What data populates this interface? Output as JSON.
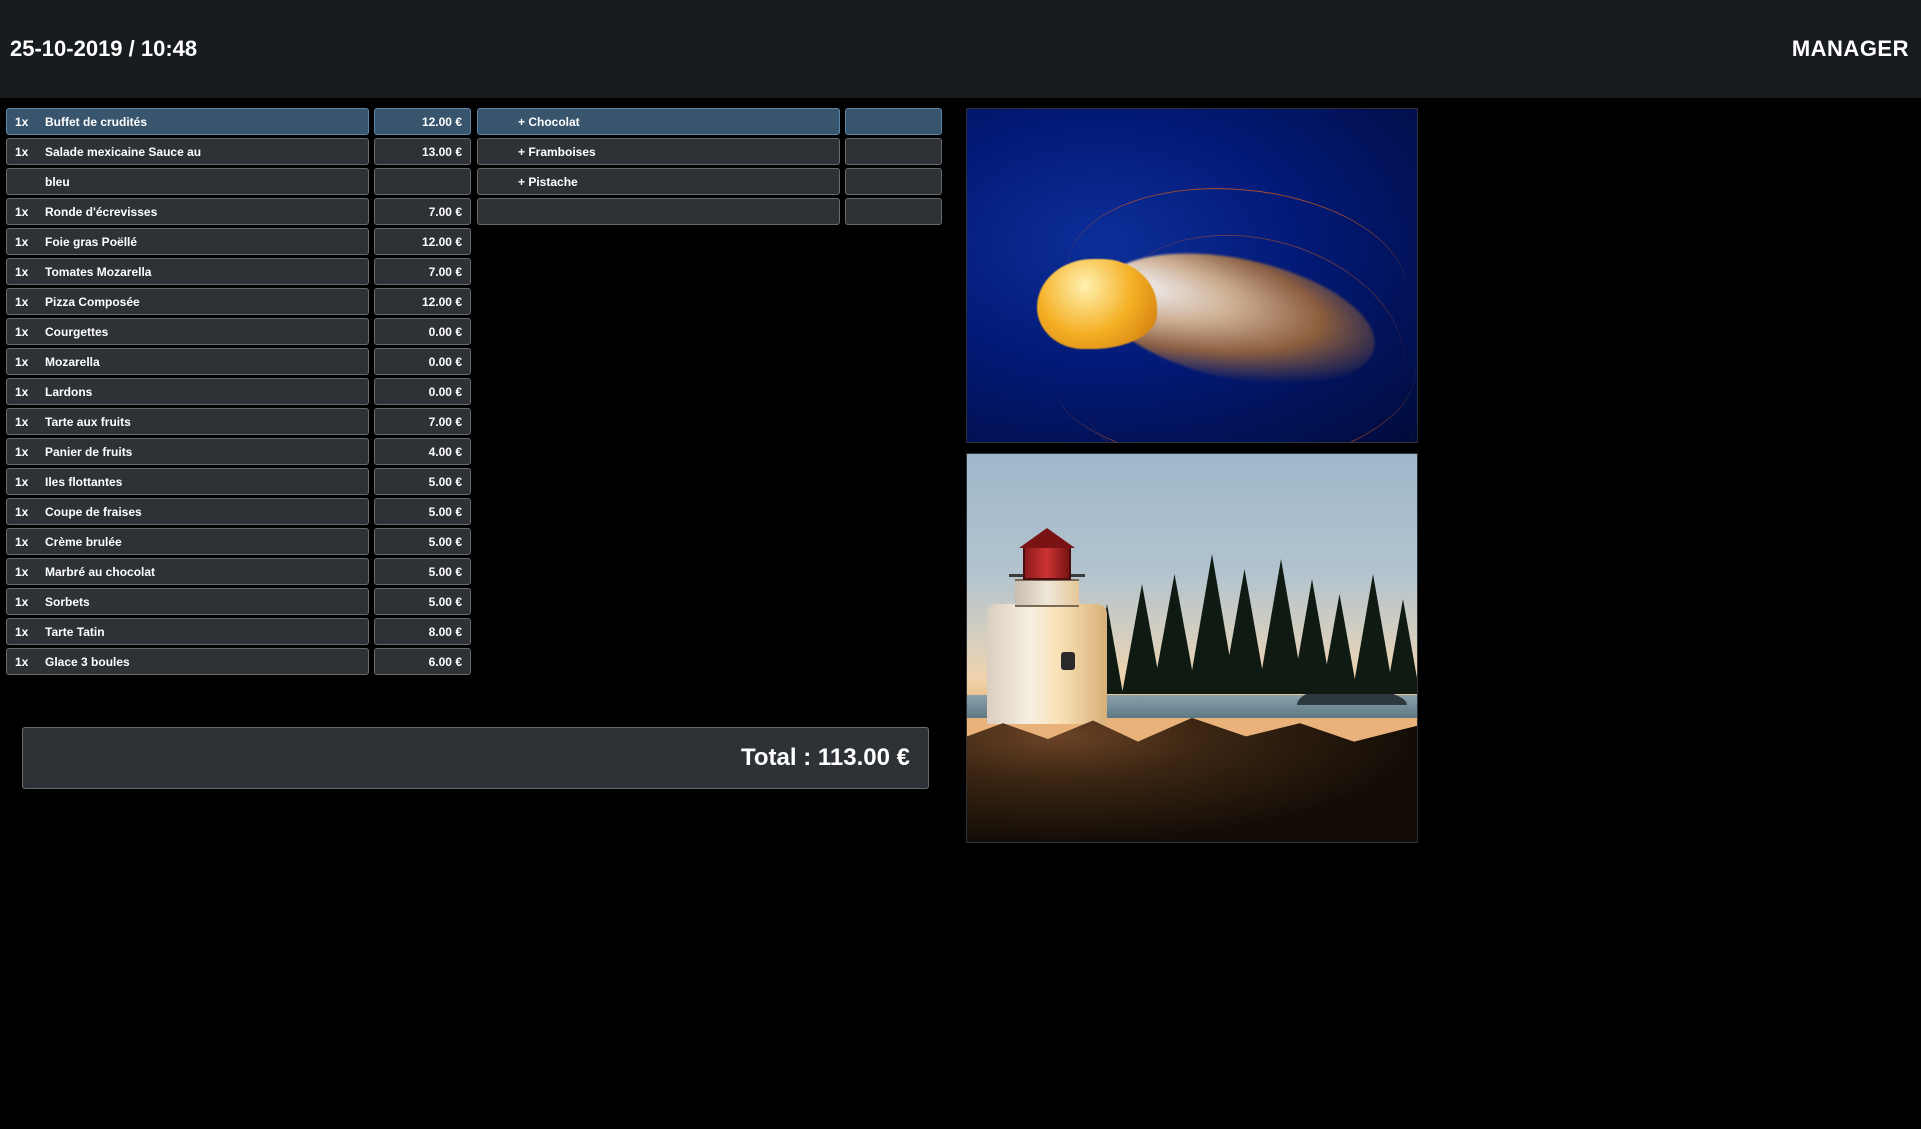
{
  "header": {
    "datetime": "25-10-2019 / 10:48",
    "role": "MANAGER"
  },
  "order": {
    "items": [
      {
        "qty": "1x",
        "name": "Buffet de crudités",
        "price": "12.00 €",
        "selected": true
      },
      {
        "qty": "1x",
        "name": "Salade mexicaine Sauce au",
        "price": "13.00 €"
      },
      {
        "qty": "",
        "name": "bleu",
        "price": ""
      },
      {
        "qty": "1x",
        "name": "Ronde d'écrevisses",
        "price": "7.00 €"
      },
      {
        "qty": "1x",
        "name": "Foie gras Poëllé",
        "price": "12.00 €"
      },
      {
        "qty": "1x",
        "name": "Tomates Mozarella",
        "price": "7.00 €"
      },
      {
        "qty": "1x",
        "name": "Pizza Composée",
        "price": "12.00 €"
      },
      {
        "qty": "1x",
        "name": "Courgettes",
        "price": "0.00 €"
      },
      {
        "qty": "1x",
        "name": "Mozarella",
        "price": "0.00 €"
      },
      {
        "qty": "1x",
        "name": "Lardons",
        "price": "0.00 €"
      },
      {
        "qty": "1x",
        "name": "Tarte aux fruits",
        "price": "7.00 €"
      },
      {
        "qty": "1x",
        "name": "Panier de fruits",
        "price": "4.00 €"
      },
      {
        "qty": "1x",
        "name": "Iles flottantes",
        "price": "5.00 €"
      },
      {
        "qty": "1x",
        "name": "Coupe de fraises",
        "price": "5.00 €"
      },
      {
        "qty": "1x",
        "name": "Crème brulée",
        "price": "5.00 €"
      },
      {
        "qty": "1x",
        "name": "Marbré au chocolat",
        "price": "5.00 €"
      },
      {
        "qty": "1x",
        "name": "Sorbets",
        "price": "5.00 €"
      },
      {
        "qty": "1x",
        "name": "Tarte Tatin",
        "price": "8.00 €"
      },
      {
        "qty": "1x",
        "name": "Glace 3 boules",
        "price": "6.00 €"
      }
    ],
    "options": [
      {
        "name": "+ Chocolat",
        "price": "",
        "selected": true
      },
      {
        "name": "+ Framboises",
        "price": ""
      },
      {
        "name": "+ Pistache",
        "price": ""
      },
      {
        "name": "",
        "price": ""
      }
    ],
    "total_label": "Total : 113.00 €"
  }
}
